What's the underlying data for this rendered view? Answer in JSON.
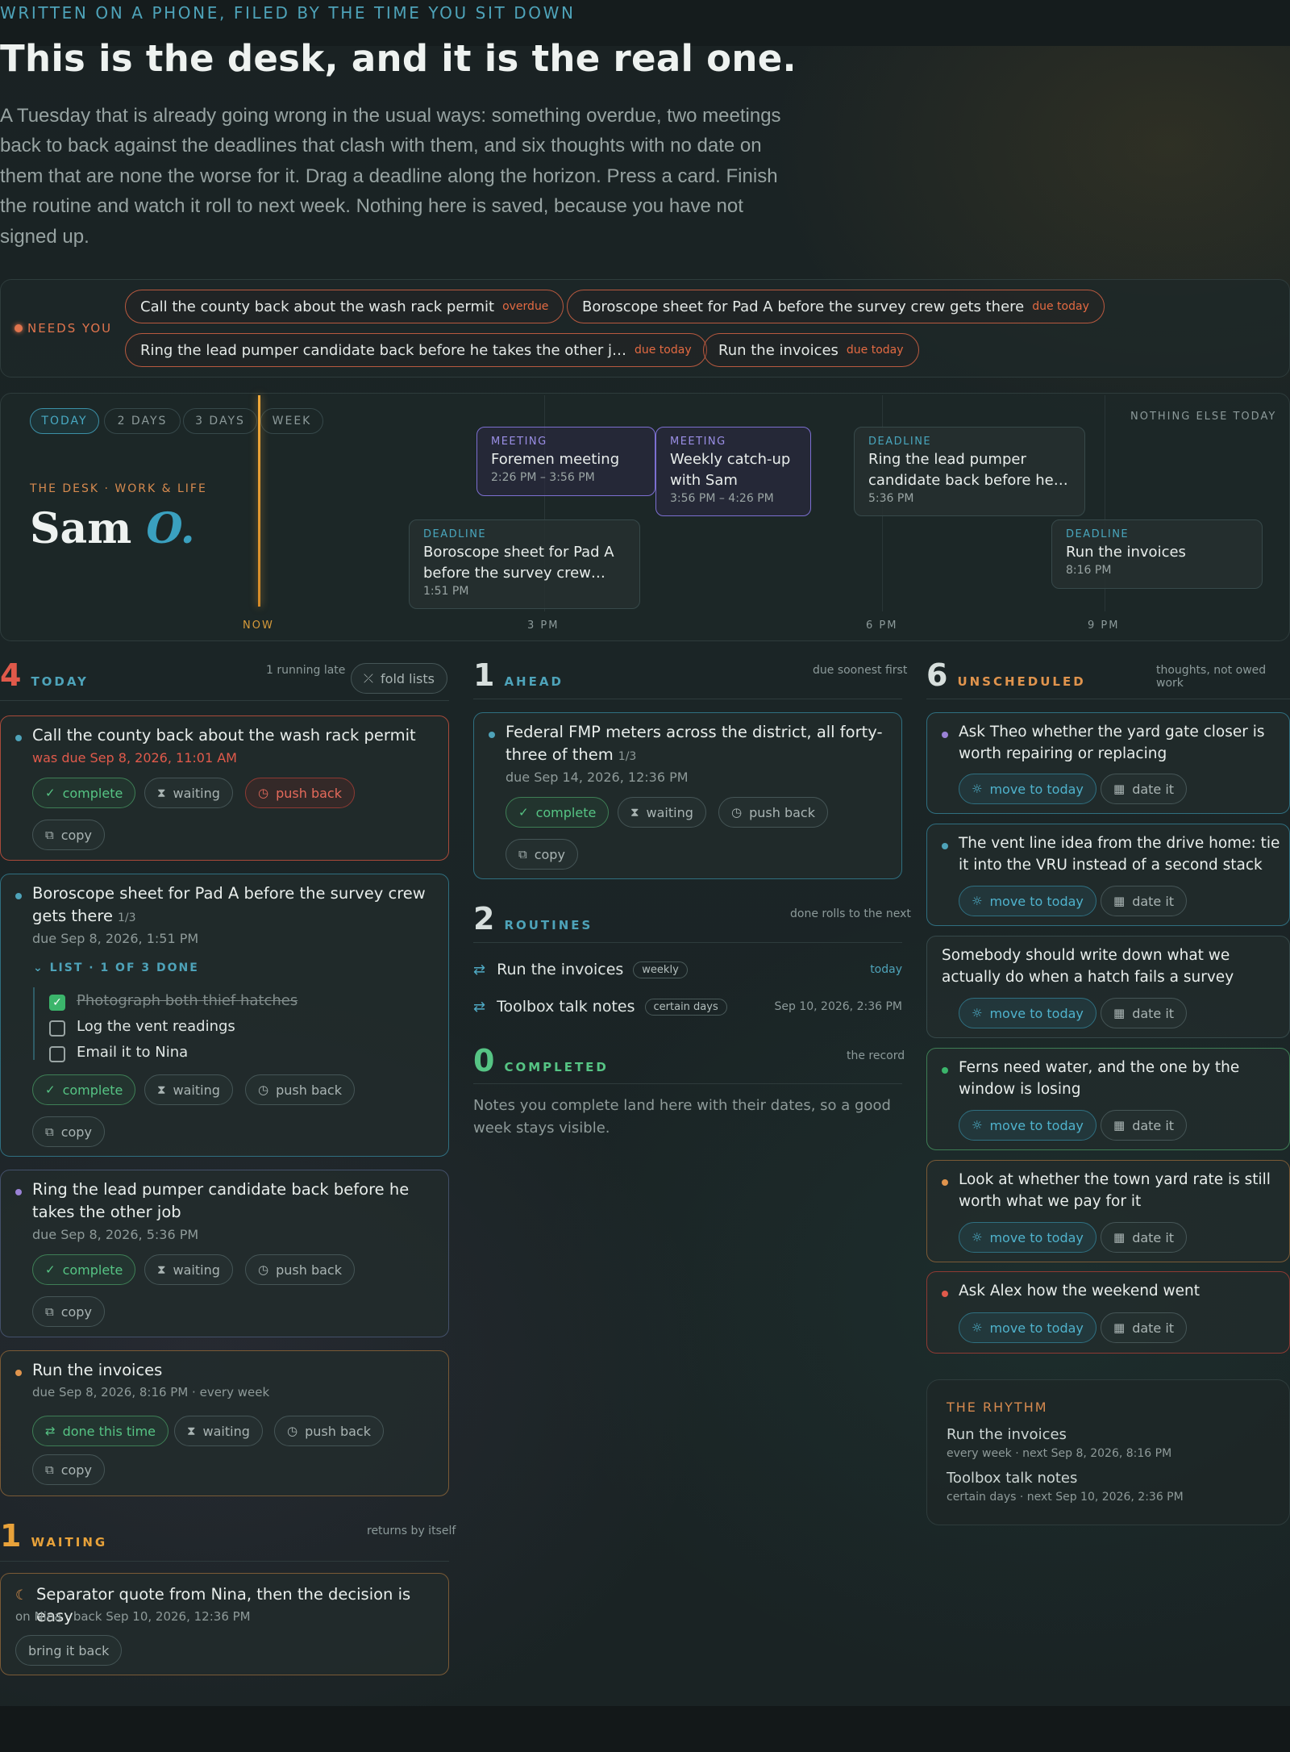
{
  "header": {
    "eyebrow": "WRITTEN ON A PHONE, FILED BY THE TIME YOU SIT DOWN",
    "title": "This is the desk, and it is the real one.",
    "intro": "A Tuesday that is already going wrong in the usual ways: something overdue, two meetings back to back against the deadlines that clash with them, and six thoughts with no date on them that are none the worse for it. Drag a deadline along the horizon. Press a card. Finish the routine and watch it roll to next week. Nothing here is saved, because you have not signed up."
  },
  "needs": {
    "label": "NEEDS YOU",
    "chips": [
      {
        "text": "Call the county back about the wash rack permit",
        "tag": "overdue"
      },
      {
        "text": "Boroscope sheet for Pad A before the survey crew gets there",
        "tag": "due today"
      },
      {
        "text": "Ring the lead pumper candidate back before he takes the other j…",
        "tag": "due today"
      },
      {
        "text": "Run the invoices",
        "tag": "due today"
      }
    ]
  },
  "timeline": {
    "ranges": [
      "TODAY",
      "2 DAYS",
      "3 DAYS",
      "WEEK"
    ],
    "nothing": "NOTHING ELSE TODAY",
    "desk_label": "THE DESK · WORK & LIFE",
    "owner_first": "Sam",
    "owner_last": "O.",
    "axis": [
      "NOW",
      "3 PM",
      "6 PM",
      "9 PM"
    ],
    "events": [
      {
        "kind": "MEETING",
        "name": "Foremen meeting",
        "time": "2:26 PM – 3:56 PM"
      },
      {
        "kind": "MEETING",
        "name": "Weekly catch-up with Sam",
        "time": "3:56 PM – 4:26 PM"
      },
      {
        "kind": "DEADLINE",
        "name": "Ring the lead pumper candidate back before he…",
        "time": "5:36 PM"
      },
      {
        "kind": "DEADLINE",
        "name": "Boroscope sheet for Pad A before the survey crew…",
        "time": "1:51 PM"
      },
      {
        "kind": "DEADLINE",
        "name": "Run the invoices",
        "time": "8:16 PM"
      }
    ]
  },
  "today": {
    "count": "4",
    "label": "TODAY",
    "note": "1 running late",
    "fold": "fold lists",
    "cards": [
      {
        "title": "Call the county back about the wash rack permit",
        "sub": "was due Sep 8, 2026, 11:01 AM",
        "complete": "complete",
        "waiting": "waiting",
        "push": "push back",
        "copy": "copy"
      },
      {
        "title_a": "Boroscope sheet for Pad A before the survey crew",
        "title_b": "gets there",
        "frac": "1/3",
        "sub": "due Sep 8, 2026, 1:51 PM",
        "list": "LIST · 1 OF 3 DONE",
        "items": [
          "Photograph both thief hatches",
          "Log the vent readings",
          "Email it to Nina"
        ],
        "complete": "complete",
        "waiting": "waiting",
        "push": "push back",
        "copy": "copy"
      },
      {
        "title_a": "Ring the lead pumper candidate back before he",
        "title_b": "takes the other job",
        "sub": "due Sep 8, 2026, 5:36 PM",
        "complete": "complete",
        "waiting": "waiting",
        "push": "push back",
        "copy": "copy"
      },
      {
        "title": "Run the invoices",
        "sub": "due Sep 8, 2026, 8:16 PM · every week",
        "done": "done this time",
        "waiting": "waiting",
        "push": "push back",
        "copy": "copy"
      }
    ]
  },
  "waiting": {
    "count": "1",
    "label": "WAITING",
    "note": "returns by itself",
    "card": {
      "title": "Separator quote from Nina, then the decision is easy",
      "sub": "on Nina · back Sep 10, 2026, 12:36 PM",
      "btn": "bring it back"
    }
  },
  "ahead": {
    "count": "1",
    "label": "AHEAD",
    "note": "due soonest first",
    "card": {
      "title_a": "Federal FMP meters across the district, all forty-",
      "title_b": "three of them",
      "frac": "1/3",
      "sub": "due Sep 14, 2026, 12:36 PM",
      "complete": "complete",
      "waiting": "waiting",
      "push": "push back",
      "copy": "copy"
    }
  },
  "routines": {
    "count": "2",
    "label": "ROUTINES",
    "note": "done rolls to the next",
    "items": [
      {
        "name": "Run the invoices",
        "pill": "weekly",
        "when": "today"
      },
      {
        "name": "Toolbox talk notes",
        "pill": "certain days",
        "when": "Sep 10, 2026, 2:36 PM"
      }
    ]
  },
  "completed": {
    "count": "0",
    "label": "COMPLETED",
    "note": "the record",
    "empty": "Notes you complete land here with their dates, so a good week stays visible."
  },
  "unscheduled": {
    "count": "6",
    "label": "UNSCHEDULED",
    "note": "thoughts, not owed work",
    "move": "move to today",
    "date": "date it",
    "items": [
      {
        "a": "Ask Theo whether the yard gate closer is",
        "b": "worth repairing or replacing"
      },
      {
        "a": "The vent line idea from the drive home: tie",
        "b": "it into the VRU instead of a second stack"
      },
      {
        "a": "Somebody should write down what we",
        "b": "actually do when a hatch fails a survey"
      },
      {
        "a": "Ferns need water, and the one by the",
        "b": "window is losing"
      },
      {
        "a": "Look at whether the town yard rate is still",
        "b": "worth what we pay for it"
      },
      {
        "a": "Ask Alex how the weekend went",
        "b": ""
      }
    ]
  },
  "rhythm": {
    "title": "THE RHYTHM",
    "items": [
      {
        "name": "Run the invoices",
        "meta": "every week · next Sep 8, 2026, 8:16 PM"
      },
      {
        "name": "Toolbox talk notes",
        "meta": "certain days · next Sep 10, 2026, 2:36 PM"
      }
    ]
  },
  "colors": {
    "accent": "#4ea3b9",
    "overdue": "#e05a4b",
    "done": "#56c484",
    "meeting": "#7c6fd0",
    "now": "#f0a93a"
  }
}
